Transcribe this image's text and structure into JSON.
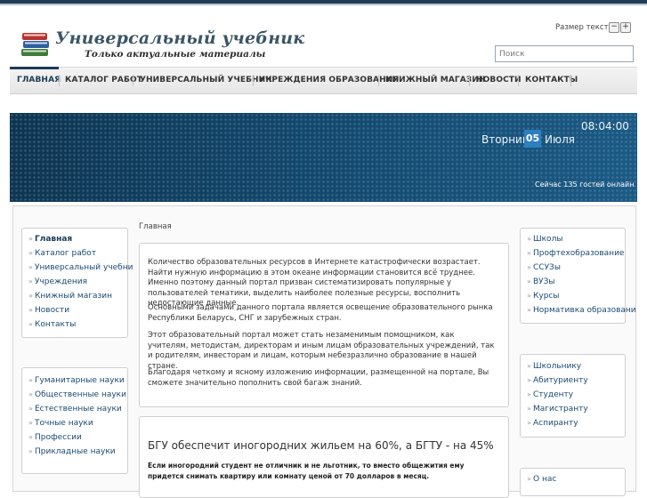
{
  "header": {
    "title": "Универсальный учебник",
    "subtitle": "Только актуальные материалы",
    "text_size_label": "Размер текста",
    "text_smaller": "−",
    "text_larger": "+",
    "search_placeholder": "Поиск"
  },
  "menu": {
    "items": [
      {
        "label": "ГЛАВНАЯ"
      },
      {
        "label": "КАТАЛОГ РАБОТ"
      },
      {
        "label": "УНИВЕРСАЛЬНЫЙ УЧЕБНИК"
      },
      {
        "label": "УЧРЕЖДЕНИЯ ОБРАЗОВАНИЯ"
      },
      {
        "label": "КНИЖНЫЙ МАГАЗИН"
      },
      {
        "label": "НОВОСТИ"
      },
      {
        "label": "КОНТАКТЫ"
      }
    ]
  },
  "banner": {
    "time": "08:04:00",
    "weekday": "Вторник",
    "day": "05",
    "month": "Июля",
    "online": "Сейчас 135 гостей онлайн"
  },
  "left_menu": {
    "items": [
      {
        "label": "Главная"
      },
      {
        "label": "Каталог работ"
      },
      {
        "label": "Универсальный учебни"
      },
      {
        "label": "Учреждения"
      },
      {
        "label": "Книжный магазин"
      },
      {
        "label": "Новости"
      },
      {
        "label": "Контакты"
      }
    ]
  },
  "left_subjects": {
    "items": [
      {
        "label": "Гуманитарные науки"
      },
      {
        "label": "Общественные науки"
      },
      {
        "label": "Естественные науки"
      },
      {
        "label": "Точные науки"
      },
      {
        "label": "Профессии"
      },
      {
        "label": "Прикладные науки"
      }
    ]
  },
  "breadcrumb": "Главная",
  "content": {
    "paragraphs": [
      "Количество образовательных ресурсов в Интернете катастрофически возрастает. Найти нужную информацию в этом океане информации становится всё труднее. Именно поэтому данный портал призван систематизировать популярные у пользователей тематики, выделить наиболее полезные ресурсы, восполнить недостающие данные.",
      "Основными задачами данного портала является освещение образовательного рынка Республики Беларусь, СНГ и зарубежных стран.",
      "Этот образовательный портал может стать незаменимым помощником, как учителям, методистам, директорам и иным лицам образовательных учреждений, так и родителям, инвесторам и лицам, которым небезразлично образование в нашей стране.",
      "Благодаря четкому и ясному изложению информации, размещенной на портале, Вы сможете значительно пополнить свой багаж знаний."
    ]
  },
  "news": {
    "title": "БГУ обеспечит иногородних жильем на 60%, а БГТУ - на 45%",
    "lead": "Если иногородний студент не отличник и не льготник, то вместо общежития ему придется снимать квартиру или комнату ценой от 70 долларов в месяц."
  },
  "right_institutions": {
    "items": [
      {
        "label": "Школы"
      },
      {
        "label": "Профтехобразование"
      },
      {
        "label": "ССУЗы"
      },
      {
        "label": "ВУЗы"
      },
      {
        "label": "Курсы"
      },
      {
        "label": "Нормативка образовани"
      }
    ]
  },
  "right_audience": {
    "items": [
      {
        "label": "Школьнику"
      },
      {
        "label": "Абитуриенту"
      },
      {
        "label": "Студенту"
      },
      {
        "label": "Магистранту"
      },
      {
        "label": "Аспиранту"
      }
    ]
  },
  "right_about": {
    "items": [
      {
        "label": "О нас"
      }
    ]
  },
  "colors": {
    "accent": "#1b3b57",
    "link": "#1b4a73",
    "banner": "#14476b",
    "date_box": "#2d7fc0"
  }
}
